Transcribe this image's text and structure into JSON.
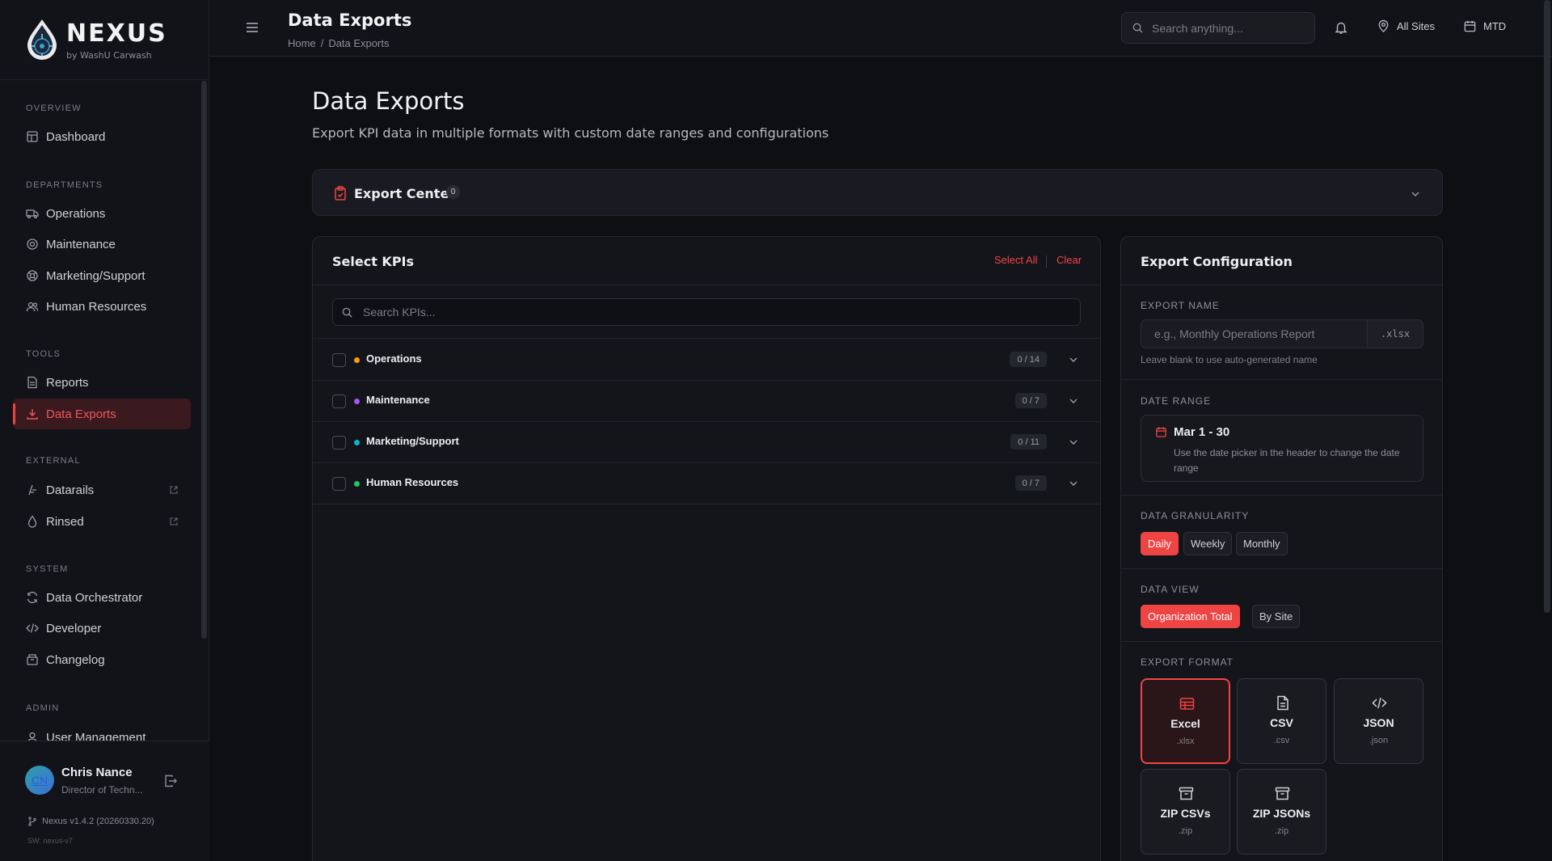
{
  "brand": {
    "name": "NEXUS",
    "sub": "by WashU Carwash"
  },
  "sidebar": {
    "sections": [
      {
        "label": "OVERVIEW"
      },
      {
        "label": "DEPARTMENTS"
      },
      {
        "label": "TOOLS"
      },
      {
        "label": "EXTERNAL"
      },
      {
        "label": "SYSTEM"
      },
      {
        "label": "ADMIN"
      }
    ],
    "items": [
      {
        "label": "Dashboard",
        "icon": "dashboard-icon"
      },
      {
        "label": "Operations",
        "icon": "truck-icon"
      },
      {
        "label": "Maintenance",
        "icon": "gear-icon"
      },
      {
        "label": "Marketing/Support",
        "icon": "lifebuoy-icon"
      },
      {
        "label": "Human Resources",
        "icon": "users-icon"
      },
      {
        "label": "Reports",
        "icon": "file-icon"
      },
      {
        "label": "Data Exports",
        "icon": "download-icon",
        "active": true
      },
      {
        "label": "Datarails",
        "icon": "rail-icon",
        "external": true
      },
      {
        "label": "Rinsed",
        "icon": "droplet-icon",
        "external": true
      },
      {
        "label": "Data Orchestrator",
        "icon": "refresh-icon"
      },
      {
        "label": "Developer",
        "icon": "code-icon"
      },
      {
        "label": "Changelog",
        "icon": "archive-icon"
      },
      {
        "label": "User Management",
        "icon": "user-icon"
      }
    ]
  },
  "user": {
    "initials": "CN",
    "name": "Chris Nance",
    "role": "Director of Techn...",
    "version": "Nexus  v1.4.2 (20260330.20)",
    "sw": "SW: nexus-v7"
  },
  "topbar": {
    "title": "Data Exports",
    "breadcrumb": [
      "Home",
      "/",
      "Data Exports"
    ],
    "search_placeholder": "Search anything...",
    "sites_label": "All Sites",
    "period_label": "MTD"
  },
  "main": {
    "title": "Data Exports",
    "subtitle": "Export KPI data in multiple formats with custom date ranges and configurations",
    "export_center": {
      "label": "Export Center",
      "count": "0"
    }
  },
  "kpi_panel": {
    "title": "Select KPIs",
    "select_all": "Select All",
    "clear": "Clear",
    "search_placeholder": "Search KPIs...",
    "groups": [
      {
        "name": "Operations",
        "count": "0 / 14",
        "color": "#f59e0b"
      },
      {
        "name": "Maintenance",
        "count": "0 / 7",
        "color": "#a855f7"
      },
      {
        "name": "Marketing/Support",
        "count": "0 / 11",
        "color": "#06b6d4"
      },
      {
        "name": "Human Resources",
        "count": "0 / 7",
        "color": "#22c55e"
      }
    ]
  },
  "config": {
    "title": "Export Configuration",
    "export_name": {
      "label": "EXPORT NAME",
      "placeholder": "e.g., Monthly Operations Report",
      "ext": ".xlsx",
      "hint": "Leave blank to use auto-generated name"
    },
    "date_range": {
      "label": "DATE RANGE",
      "value": "Mar 1 - 30",
      "note": "Use the date picker in the header to change the date range"
    },
    "granularity": {
      "label": "DATA GRANULARITY",
      "options": [
        "Daily",
        "Weekly",
        "Monthly"
      ],
      "selected": "Daily"
    },
    "view": {
      "label": "DATA VIEW",
      "options": [
        "Organization Total",
        "By Site"
      ],
      "selected": "Organization Total"
    },
    "format": {
      "label": "EXPORT FORMAT",
      "options": [
        {
          "name": "Excel",
          "ext": ".xlsx",
          "icon": "table-icon"
        },
        {
          "name": "CSV",
          "ext": ".csv",
          "icon": "document-icon"
        },
        {
          "name": "JSON",
          "ext": ".json",
          "icon": "code-icon"
        },
        {
          "name": "ZIP CSVs",
          "ext": ".zip",
          "icon": "archive-icon"
        },
        {
          "name": "ZIP JSONs",
          "ext": ".zip",
          "icon": "archive-icon"
        }
      ],
      "selected": "Excel"
    }
  },
  "colors": {
    "accent": "#ef4444",
    "background": "#0e0f13",
    "panel": "#14151b"
  }
}
